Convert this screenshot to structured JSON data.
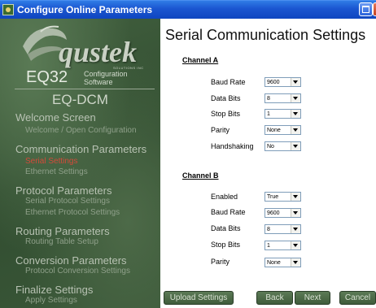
{
  "window": {
    "title": "Configure Online Parameters"
  },
  "sidebar": {
    "logo_text": "qustek",
    "logo_sub": "SOLUTIONS INC",
    "product_line": "EQ32",
    "product_line_desc_1": "Configuration",
    "product_line_desc_2": "Software",
    "product": "EQ-DCM",
    "groups": [
      {
        "label": "Welcome Screen",
        "items": [
          {
            "label": "Welcome / Open Configuration"
          }
        ]
      },
      {
        "label": "Communication Parameters",
        "items": [
          {
            "label": "Serial Settings"
          },
          {
            "label": "Ethernet Settings"
          }
        ]
      },
      {
        "label": "Protocol Parameters",
        "items": [
          {
            "label": "Serial Protocol Settings"
          },
          {
            "label": "Ethernet Protocol Settings"
          }
        ]
      },
      {
        "label": "Routing Parameters",
        "items": [
          {
            "label": "Routing Table Setup"
          }
        ]
      },
      {
        "label": "Conversion Parameters",
        "items": [
          {
            "label": "Protocol Conversion Settings"
          }
        ]
      },
      {
        "label": "Finalize Settings",
        "items": [
          {
            "label": "Apply Settings"
          }
        ]
      }
    ]
  },
  "main": {
    "title": "Serial Communication Settings",
    "channel_a": {
      "label": "Channel A",
      "fields": [
        {
          "label": "Baud Rate",
          "value": "9600"
        },
        {
          "label": "Data Bits",
          "value": "8"
        },
        {
          "label": "Stop Bits",
          "value": "1"
        },
        {
          "label": "Parity",
          "value": "None"
        },
        {
          "label": "Handshaking",
          "value": "No"
        }
      ]
    },
    "channel_b": {
      "label": "Channel B",
      "fields": [
        {
          "label": "Enabled",
          "value": "True"
        },
        {
          "label": "Baud Rate",
          "value": "9600"
        },
        {
          "label": "Data Bits",
          "value": "8"
        },
        {
          "label": "Stop Bits",
          "value": "1"
        },
        {
          "label": "Parity",
          "value": "None"
        }
      ]
    }
  },
  "buttons": {
    "upload": "Upload Settings",
    "back": "Back",
    "next": "Next",
    "cancel": "Cancel"
  },
  "colors": {
    "titlebar": "#1a55d0",
    "sidebar_bg": "#3a5738",
    "active_nav": "#d34a3a"
  },
  "icons": {
    "app": "app-logo-icon",
    "maximize": "maximize-icon",
    "close": "close-icon",
    "dropdown": "chevron-down-icon"
  }
}
